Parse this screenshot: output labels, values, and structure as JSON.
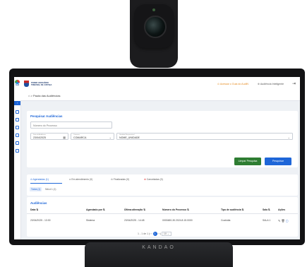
{
  "device": {
    "brand": "KANDAO"
  },
  "sidebar": {
    "logo_text": "Audi"
  },
  "header": {
    "org_line1": "PODER JUDICIÁRIO",
    "org_line2": "TRIBUNAL DE JUSTIÇA",
    "guide_link": "Acessar o Guia do AudiN",
    "ai_label": "Audiência Inteligente"
  },
  "breadcrumb": {
    "home_icon": "home-icon",
    "page": "Pauta das Audiências"
  },
  "search": {
    "title": "Pesquisar Audiências",
    "process_placeholder": "Número do Processo",
    "date_label": "Data da Audiência",
    "date_value": "23/04/2025",
    "comarca_label": "Comarca",
    "comarca_value": "COMARCA",
    "unit_label": "Unidade Responsável",
    "unit_value": "NOME_UNIDADE",
    "clear_button": "Limpar Pesquisa",
    "search_button": "Pesquisar"
  },
  "tabs": [
    {
      "label": "Agendadas (1)"
    },
    {
      "label": "Em atendimento (0)"
    },
    {
      "label": "Finalizadas (0)"
    },
    {
      "label": "Canceladas (0)"
    }
  ],
  "subtabs": [
    {
      "label": "Todas (1)"
    },
    {
      "label": "SALA 1 (1)"
    }
  ],
  "table": {
    "title": "Audiências",
    "columns": [
      "Data",
      "Agendado por",
      "Última alteração",
      "Número do Processo",
      "Tipo de audiência",
      "Sala",
      "Ações"
    ],
    "rows": [
      {
        "date": "23/04/2025 - 13:30",
        "scheduled_by": "Sistema",
        "last_change": "23/04/2025 - 14:48",
        "process": "0000480-30.2024.8.15.0000",
        "type": "Custódia",
        "room": "SALA 1"
      }
    ]
  },
  "pagination": {
    "range": "1 - 1 de 1",
    "current_page": "1",
    "page_size": "10"
  },
  "colors": {
    "primary": "#1e66d8",
    "success": "#2e7d32",
    "accent": "#e58a1f"
  }
}
